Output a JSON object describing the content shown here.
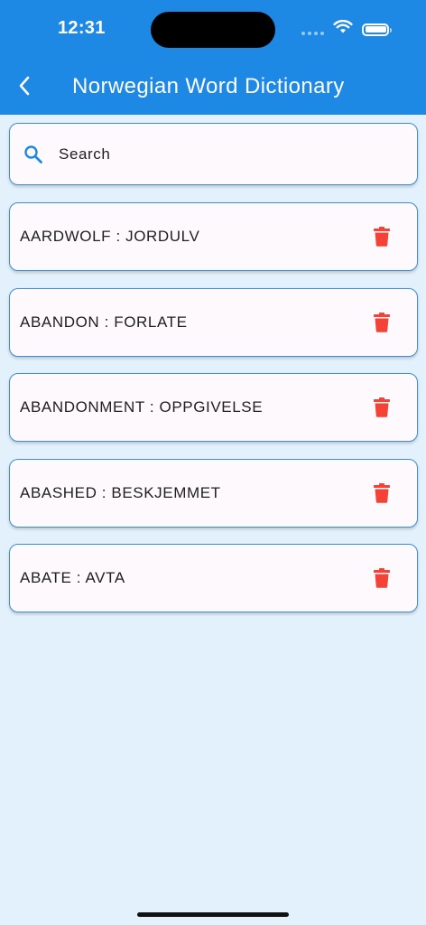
{
  "status_bar": {
    "time": "12:31",
    "icons": [
      "cellular-signal-icon",
      "wifi-icon",
      "battery-icon"
    ]
  },
  "app_bar": {
    "back_icon": "chevron-left-icon",
    "title": "Norwegian Word Dictionary",
    "background_color": "#1E88E5"
  },
  "search": {
    "icon": "search-icon",
    "placeholder": "Search",
    "value": ""
  },
  "words": [
    {
      "label": "AARDWOLF : JORDULV",
      "action_icon": "trash-icon"
    },
    {
      "label": "ABANDON : FORLATE",
      "action_icon": "trash-icon"
    },
    {
      "label": "ABANDONMENT : OPPGIVELSE",
      "action_icon": "trash-icon"
    },
    {
      "label": "ABASHED : BESKJEMMET",
      "action_icon": "trash-icon"
    },
    {
      "label": "ABATE : AVTA",
      "action_icon": "trash-icon"
    }
  ],
  "colors": {
    "accent": "#1E88E5",
    "card_border": "#3D8ED8",
    "card_background": "#FEF9FD",
    "page_background": "#E3F1FC",
    "delete": "#F44336"
  }
}
